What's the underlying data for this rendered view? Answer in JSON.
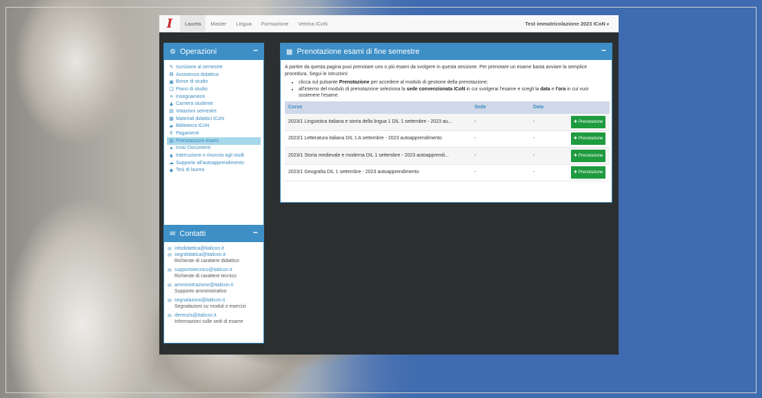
{
  "navbar": {
    "brand_glyph": "I",
    "items": [
      {
        "label": "Laurea",
        "active": true
      },
      {
        "label": "Master",
        "active": false
      },
      {
        "label": "Lingua",
        "active": false
      },
      {
        "label": "Formazione",
        "active": false
      },
      {
        "label": "Vetrina ICoN",
        "active": false
      }
    ],
    "user_label": "Test immatricolazione 2023 ICoN"
  },
  "operations": {
    "title": "Operazioni",
    "items": [
      {
        "label": "Iscrizione al semestre",
        "icon": "edit-icon",
        "active": false
      },
      {
        "label": "Assistenza didattica",
        "icon": "support-icon",
        "active": false
      },
      {
        "label": "Borse di studio",
        "icon": "money-icon",
        "active": false
      },
      {
        "label": "Piano di studio",
        "icon": "book-open-icon",
        "active": false
      },
      {
        "label": "Insegnamenti",
        "icon": "list-icon",
        "active": false
      },
      {
        "label": "Carriera studente",
        "icon": "user-icon",
        "active": false
      },
      {
        "label": "Votazioni semestre",
        "icon": "file-icon",
        "active": false
      },
      {
        "label": "Materiali didattici ICoN",
        "icon": "grid-icon",
        "active": false
      },
      {
        "label": "Biblioteca ICoN",
        "icon": "book-icon",
        "active": false
      },
      {
        "label": "Pagamenti",
        "icon": "euro-icon",
        "active": false
      },
      {
        "label": "Prenotazione esami",
        "icon": "calendar-icon",
        "active": true
      },
      {
        "label": "Invio Documenti",
        "icon": "send-icon",
        "active": false
      },
      {
        "label": "Interruzione o rinuncia agli studi",
        "icon": "user-minus-icon",
        "active": false
      },
      {
        "label": "Supporto all'autoapprendimento",
        "icon": "chat-icon",
        "active": false
      },
      {
        "label": "Tesi di laurea",
        "icon": "graduation-cap-icon",
        "active": false
      }
    ]
  },
  "contacts": {
    "title": "Contatti",
    "entries": [
      {
        "emails": [
          "infodidattica@italicon.it",
          "segrdidattica@italicon.it"
        ],
        "desc": "Richieste di carattere didattico"
      },
      {
        "emails": [
          "supportotecnico@italicon.it"
        ],
        "desc": "Richieste di carattere tecnico"
      },
      {
        "emails": [
          "amministrazione@italicon.it"
        ],
        "desc": "Supporto amministrativo"
      },
      {
        "emails": [
          "segnalazioni@italicon.it"
        ],
        "desc": "Segnalazioni su moduli o esercizi"
      },
      {
        "emails": [
          "derenzis@italicon.it"
        ],
        "desc": "Informazioni sulle sedi di esame"
      }
    ]
  },
  "main": {
    "title": "Prenotazione esami di fine semestre",
    "intro": "A partire da questa pagina puoi prenotare uno o più esami da svolgere in questa sessione. Per prenotare un esame basta avviare la semplice procedura. Segui le istruzioni:",
    "bullet1_pre": "clicca sul pulsante ",
    "bullet1_bold": "Prenotazione",
    "bullet1_post": " per accedere al modulo di gestione della prenotazione;",
    "bullet2_pre": "all'interno del modulo di prenotazione seleziona la ",
    "bullet2_bold1": "sede convenzionata ICoN",
    "bullet2_mid": " in cui svolgerai l'esame e scegli la ",
    "bullet2_bold2": "data",
    "bullet2_and": " e ",
    "bullet2_bold3": "l'ora",
    "bullet2_post": " in cui vuoi sostenere l'esame.",
    "table": {
      "headers": {
        "corso": "Corso",
        "sede": "Sede",
        "data": "Data"
      },
      "rows": [
        {
          "corso": "2023/1 Linguistica italiana e storia della lingua 1 DIL 1 settembre - 2023 au...",
          "sede": "-",
          "data": "-",
          "button": "Prenotazione"
        },
        {
          "corso": "2023/1 Letteratura italiana DIL 1 A settembre - 2023 autoapprendimento",
          "sede": "-",
          "data": "-",
          "button": "Prenotazione"
        },
        {
          "corso": "2023/1 Storia medievale e moderna DIL 1 settembre - 2023 autoapprendi...",
          "sede": "-",
          "data": "-",
          "button": "Prenotazione"
        },
        {
          "corso": "2023/1 Geografia DIL 1 settembre - 2023 autoapprendimento",
          "sede": "-",
          "data": "-",
          "button": "Prenotazione"
        }
      ]
    }
  },
  "colors": {
    "accent": "#3d8fc6",
    "button_green": "#1f9b3f",
    "active_item": "#a7d7eb",
    "background_blue": "#3f6bb0"
  }
}
